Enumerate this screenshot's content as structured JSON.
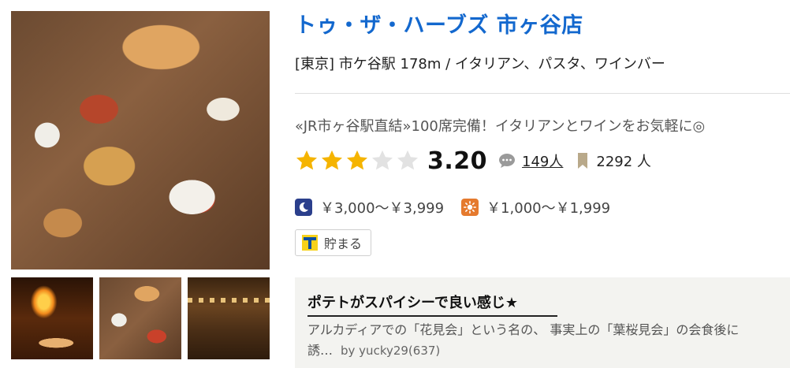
{
  "restaurant": {
    "name": "トゥ・ザ・ハーブズ 市ヶ谷店",
    "area_line": "[東京] 市ケ谷駅 178m / イタリアン、パスタ、ワインバー",
    "catchcopy": "«JR市ヶ谷駅直結»100席完備！イタリアンとワインをお気軽に◎",
    "rating": {
      "stars_filled": 3,
      "stars_total": 5,
      "score": "3.20",
      "reviews_count": "149人",
      "bookmarks_count": "2292 人"
    },
    "price": {
      "dinner": "￥3,000～￥3,999",
      "lunch": "￥1,000～￥1,999"
    },
    "tpoint_label": "貯まる"
  },
  "review": {
    "title": "ポテトがスパイシーで良い感じ★",
    "excerpt_line1": "アルカディアでの「花見会」という名の、 事実上の「葉桜見会」の会食後に",
    "excerpt_line2": "誘…",
    "byline": "by yucky29(637)"
  },
  "colors": {
    "title_link": "#1368ce",
    "star_filled": "#f5b400",
    "star_empty": "#e2e2e2",
    "night_icon_bg": "#2b3f8c",
    "lunch_icon_bg": "#e57a2e",
    "review_bg": "#f3f3f0"
  },
  "icons": {
    "comment": "comment-icon",
    "bookmark": "bookmark-icon",
    "dinner": "moon-icon",
    "lunch": "sun-icon",
    "tpoint": "tpoint-logo-icon"
  }
}
